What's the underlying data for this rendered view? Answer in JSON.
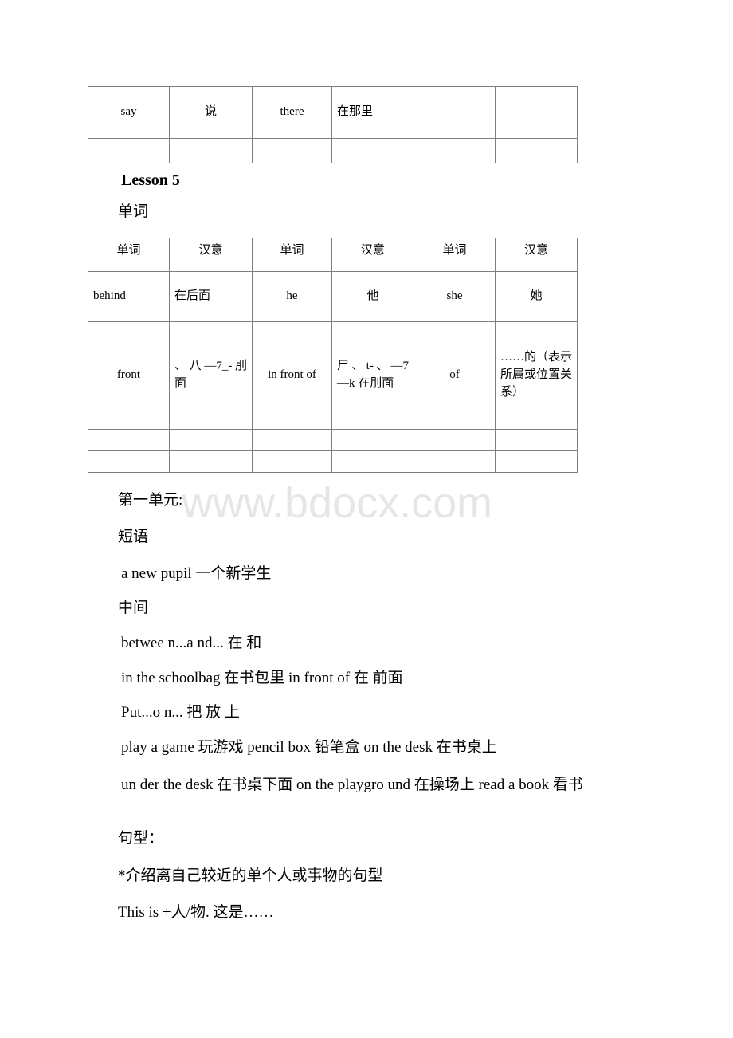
{
  "watermark": "www.bdocx.com",
  "table_top": {
    "rows": [
      [
        "say",
        "说",
        "there",
        "在那里",
        "",
        ""
      ],
      [
        "",
        "",
        "",
        "",
        "",
        ""
      ]
    ]
  },
  "lesson_heading": "Lesson 5",
  "word_heading": "单词",
  "table_vocab": {
    "headers": [
      "单词",
      "汉意",
      "单词",
      "汉意",
      "单词",
      "汉意"
    ],
    "rows": [
      [
        "behind",
        "在后面",
        "he",
        "他",
        "she",
        "她"
      ],
      [
        "front",
        "、八—7_-刖面",
        "in front of",
        "尸、t-、—7—k 在刖面",
        "of",
        "……的（表示所属或位置关系）"
      ],
      [
        "",
        "",
        "",
        "",
        "",
        ""
      ],
      [
        "",
        "",
        "",
        "",
        "",
        ""
      ]
    ]
  },
  "unit_heading": "第一单元:",
  "phrase_heading": "短语",
  "phrases": {
    "new_pupil": "a new pupil 一个新学生",
    "middle": "中间",
    "between": "betwee n...a nd... 在 和",
    "schoolbag": "in the schoolbag 在书包里 in front of 在 前面",
    "put_on": "Put...o n... 把 放 上",
    "play_game": "play a game 玩游戏 pencil box 铅笔盒 on the desk 在书桌上",
    "under_desk": "un der the desk 在书桌下面 on the playgro und 在操场上 read a book 看书"
  },
  "sentence_section": {
    "heading": "句型：",
    "intro": "*介绍离自己较近的单个人或事物的句型",
    "pattern": "This is +人/物. 这是……"
  }
}
